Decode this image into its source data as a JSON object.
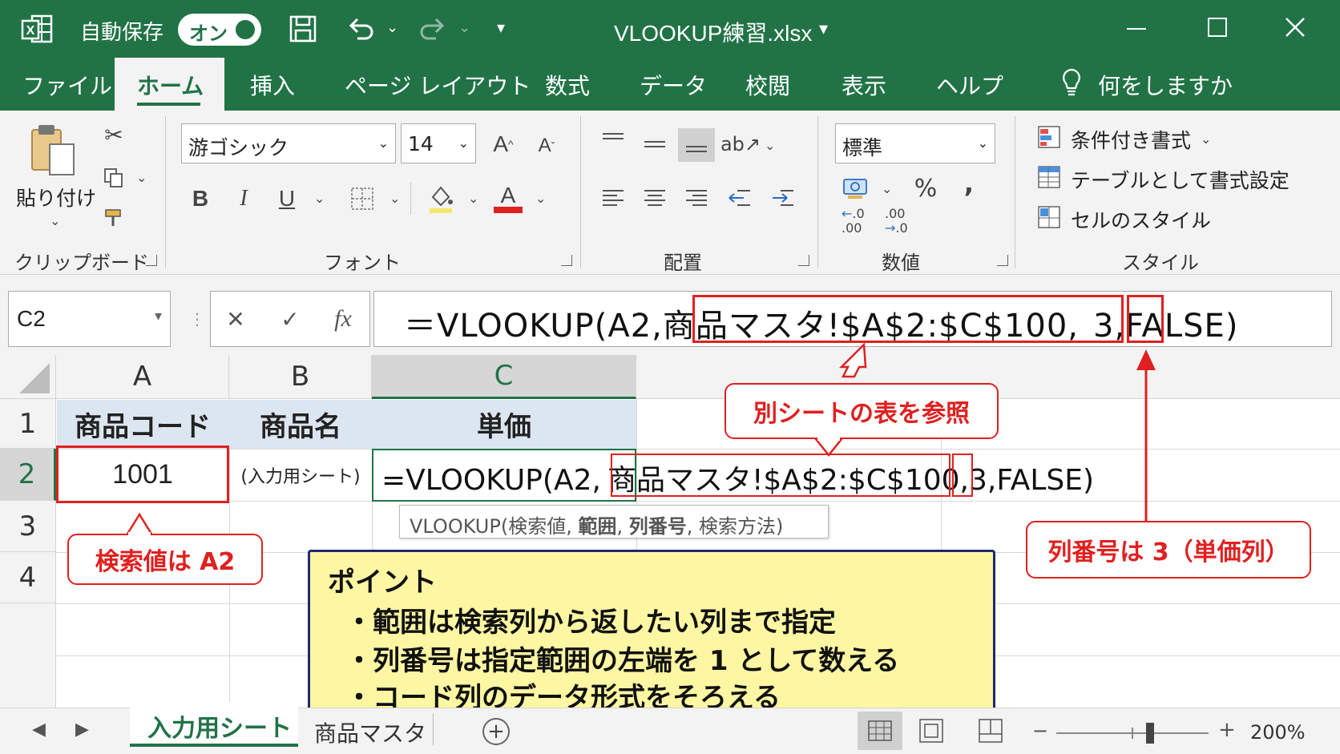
{
  "titlebar": {
    "autosave_label": "自動保存",
    "autosave_state": "オン",
    "filename": "VLOOKUP練習.xlsx"
  },
  "tabs": [
    "ファイル",
    "ホーム",
    "挿入",
    "ページ レイアウト",
    "数式",
    "データ",
    "校閲",
    "表示",
    "ヘルプ"
  ],
  "tell_me": "何をしますか",
  "ribbon": {
    "paste_label": "貼り付け",
    "clipboard_group": "クリップボード",
    "font_name": "游ゴシック",
    "font_size": "14",
    "font_group": "フォント",
    "bold": "B",
    "italic": "I",
    "underline": "U",
    "align_group": "配置",
    "number_format": "標準",
    "number_group": "数値",
    "percent": "%",
    "comma": ",",
    "dec_inc": ".00",
    "dec_dec": ".0",
    "cond_format": "条件付き書式",
    "format_table": "テーブルとして書式設定",
    "cell_styles": "セルのスタイル",
    "styles_group": "スタイル"
  },
  "formula_bar": {
    "name_box": "C2",
    "fx": "fx",
    "part1": "＝VLOOKUP(A2,",
    "part2": "商品マスタ!$A$2:$C$100,",
    "part3": "3",
    "part4": ",FALSE)"
  },
  "grid": {
    "columns": [
      "A",
      "B",
      "C"
    ],
    "rows": [
      "1",
      "2",
      "3",
      "4"
    ],
    "headers": [
      "商品コード",
      "商品名",
      "単価"
    ],
    "a2": "1001",
    "b2": "(入力用シート)",
    "c2_part1": "=VLOOKUP(A2,",
    "c2_part2": "商品マスタ!$A$2:$C$100,",
    "c2_part3": "3",
    "c2_part4": ",FALSE)",
    "tooltip_func": "VLOOKUP(",
    "tooltip_args": [
      {
        "text": "検索値, ",
        "bold": false
      },
      {
        "text": "範囲",
        "bold": true
      },
      {
        "text": ", ",
        "bold": false
      },
      {
        "text": "列番号",
        "bold": true
      },
      {
        "text": ", 検索方法)",
        "bold": false
      }
    ]
  },
  "callouts": {
    "ref_sheet": "別シートの表を参照",
    "lookup_value": "検索値は A2",
    "col_index": "列番号は 3（単価列）"
  },
  "point_box": {
    "title": "ポイント",
    "items": [
      "・範囲は検索列から返したい列まで指定",
      "・列番号は指定範囲の左端を 1 として数える",
      "・コード列のデータ形式をそろえる"
    ]
  },
  "sheets": [
    "入力用シート",
    "商品マスタ"
  ],
  "zoom": "200%",
  "colors": {
    "excel_green": "#217346",
    "callout_red": "#e02020",
    "note_bg": "#fdf7a3",
    "note_border": "#1f2a6e"
  }
}
